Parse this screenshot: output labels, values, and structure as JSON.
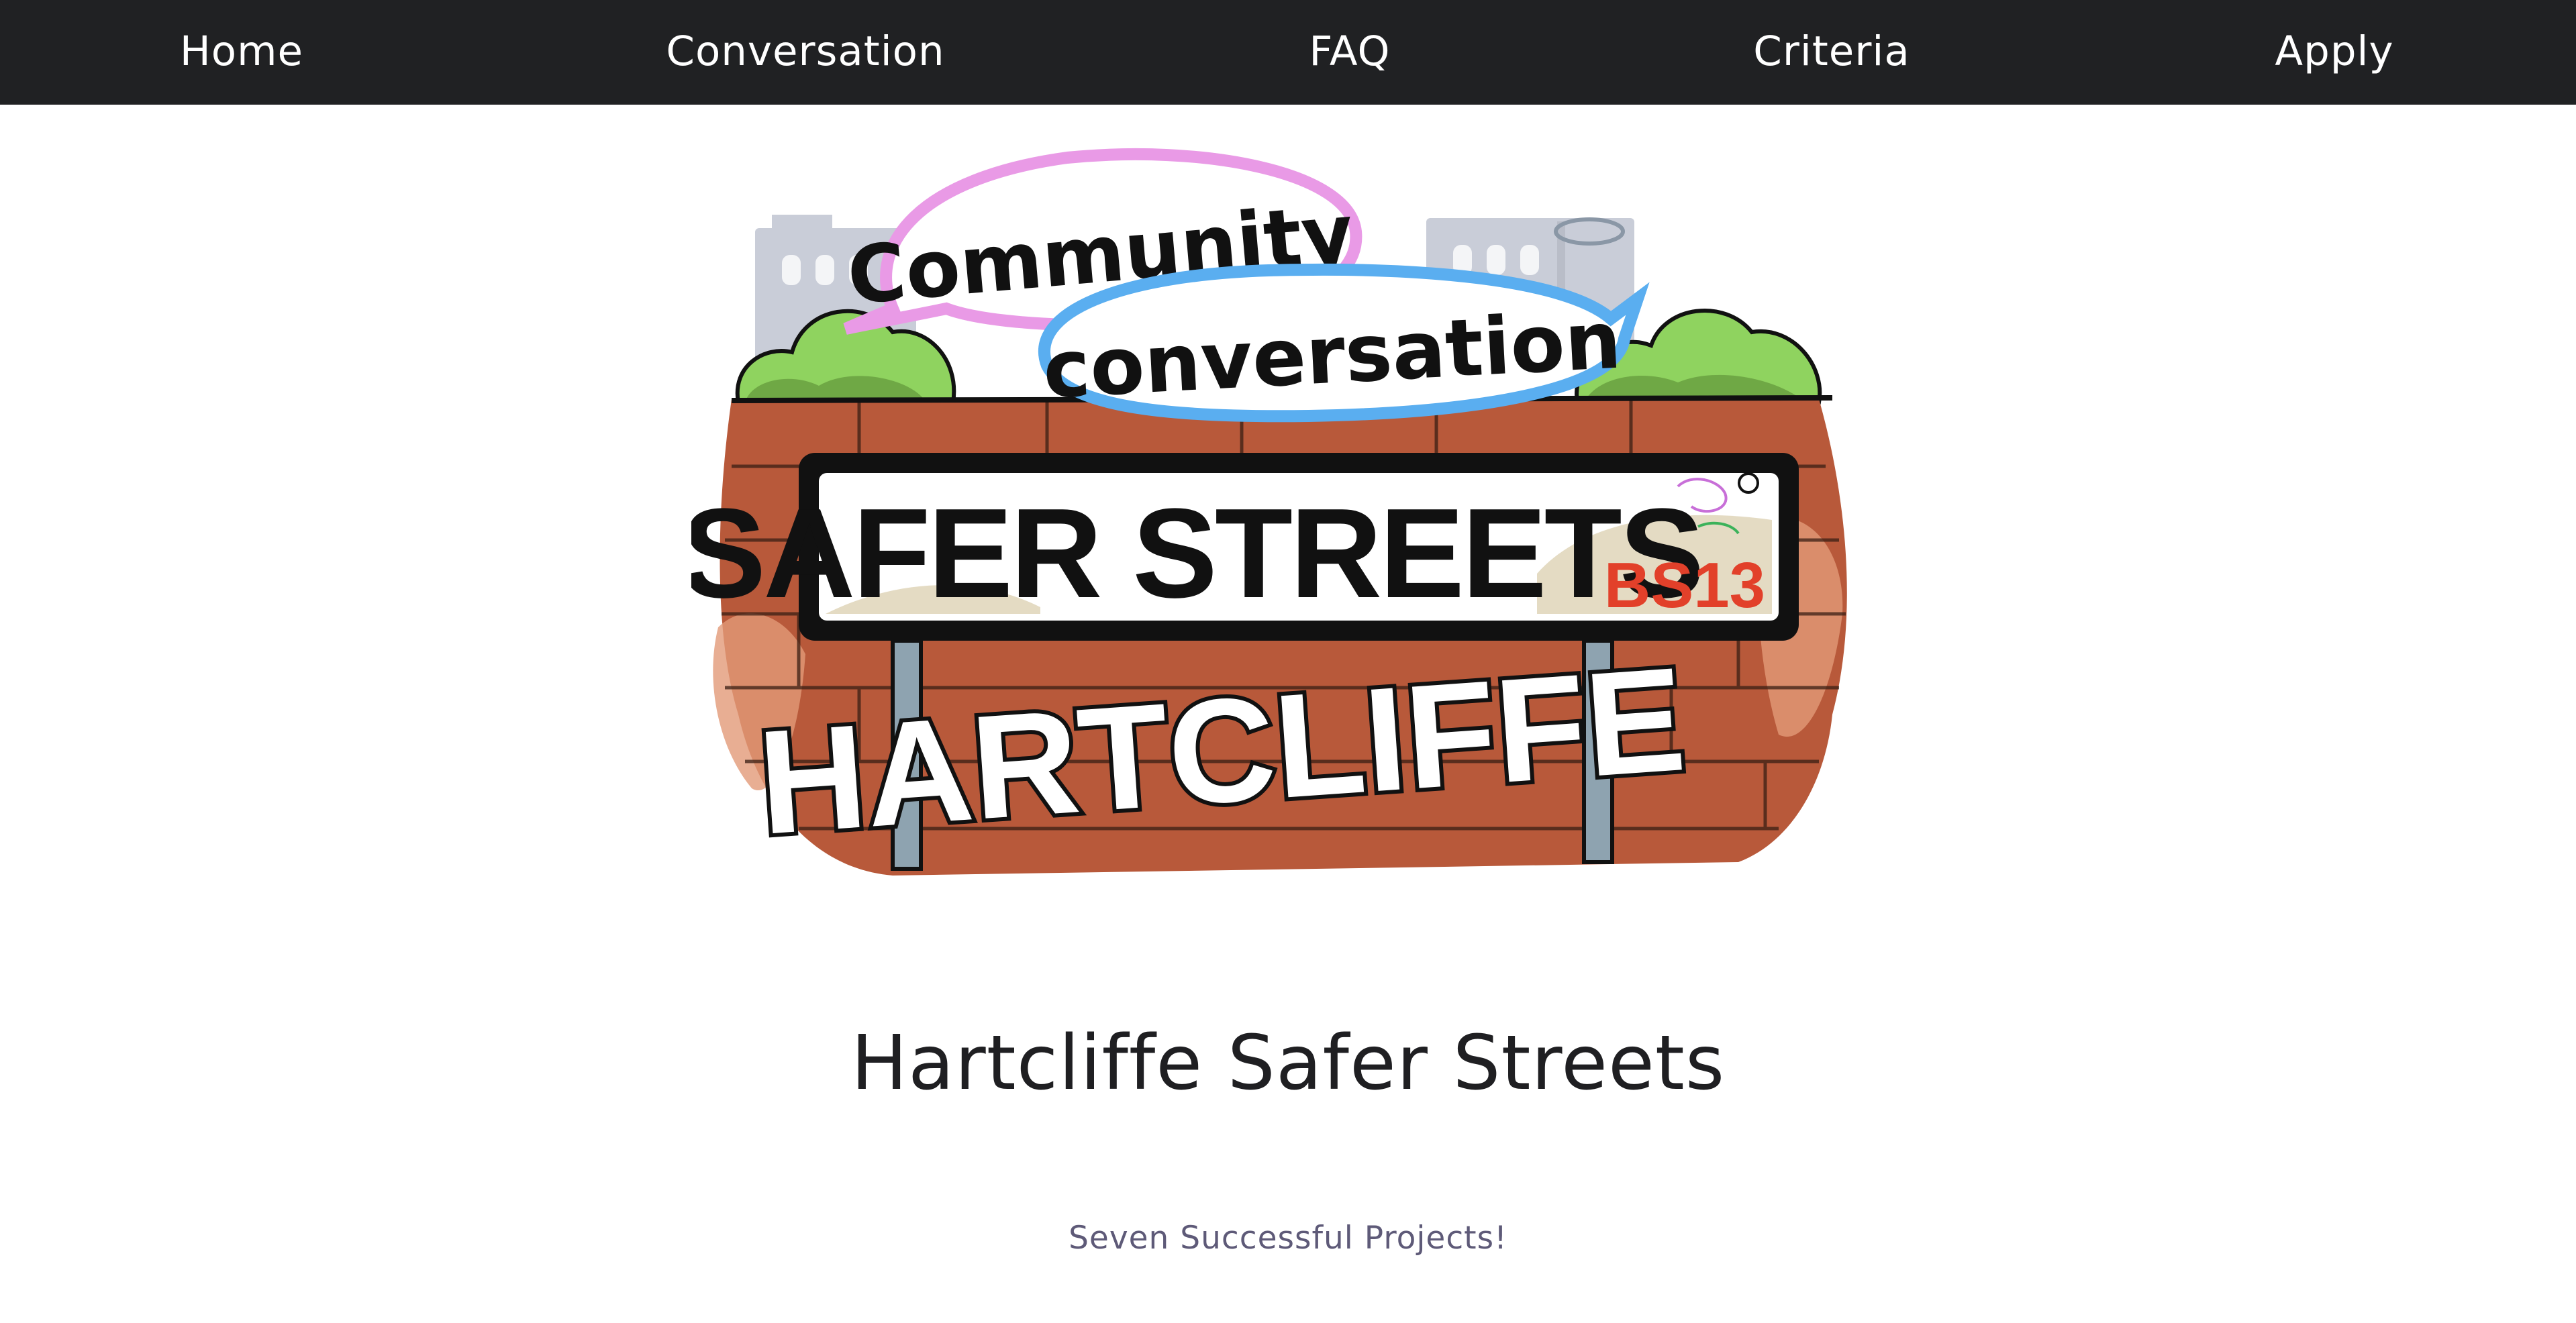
{
  "nav": {
    "items": [
      {
        "label": "Home"
      },
      {
        "label": "Conversation"
      },
      {
        "label": "FAQ"
      },
      {
        "label": "Criteria"
      },
      {
        "label": "Apply"
      }
    ]
  },
  "hero": {
    "bubble_1": "Community",
    "bubble_2": "conversation",
    "sign_main": "SAFER STREETS",
    "sign_code": "BS13",
    "sign_area": "HARTCLIFFE"
  },
  "main": {
    "title": "Hartcliffe Safer Streets",
    "subtitle": "Seven Successful Projects!"
  },
  "colors": {
    "navbar_bg": "#202123",
    "title": "#1f1f22",
    "subtitle": "#5e5a78",
    "bubble_pink": "#e99ae6",
    "bubble_blue": "#5aaef0",
    "brick": "#b8593a",
    "bush": "#8fd35f",
    "sign_code": "#e2402a"
  }
}
